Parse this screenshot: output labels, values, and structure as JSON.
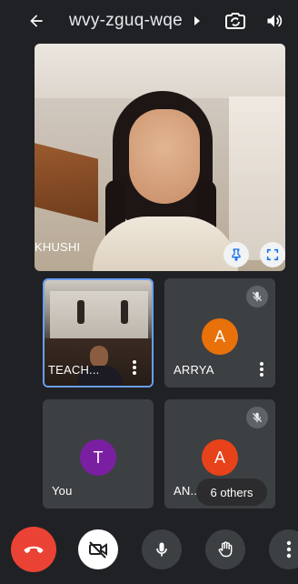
{
  "header": {
    "meeting_code": "wvy-zguq-wqe"
  },
  "main_tile": {
    "name": "KHUSHI"
  },
  "tiles": [
    {
      "name": "TEACH..."
    },
    {
      "name": "ARRYA",
      "avatar_letter": "A",
      "avatar_color": "#e8710a"
    },
    {
      "name": "You",
      "avatar_letter": "T",
      "avatar_color": "#7b1fa2"
    },
    {
      "name": "AN..",
      "avatar_letter": "A",
      "avatar_color": "#e8421a"
    }
  ],
  "others_chip": "6 others",
  "colors": {
    "background": "#202124",
    "tile": "#3c4043",
    "end_call": "#ea4335",
    "pinned_border": "#6b9ef5"
  },
  "icons": {
    "back": "arrow-left-icon",
    "caret": "caret-right-icon",
    "camera_switch": "camera-switch-icon",
    "speaker": "speaker-icon",
    "pin": "pin-icon",
    "fullscreen": "fullscreen-icon",
    "mic_off": "mic-off-icon",
    "end_call": "phone-hangup-icon",
    "camera_off": "video-off-icon",
    "mic": "mic-icon",
    "raise_hand": "hand-icon",
    "more": "more-vert-icon"
  }
}
